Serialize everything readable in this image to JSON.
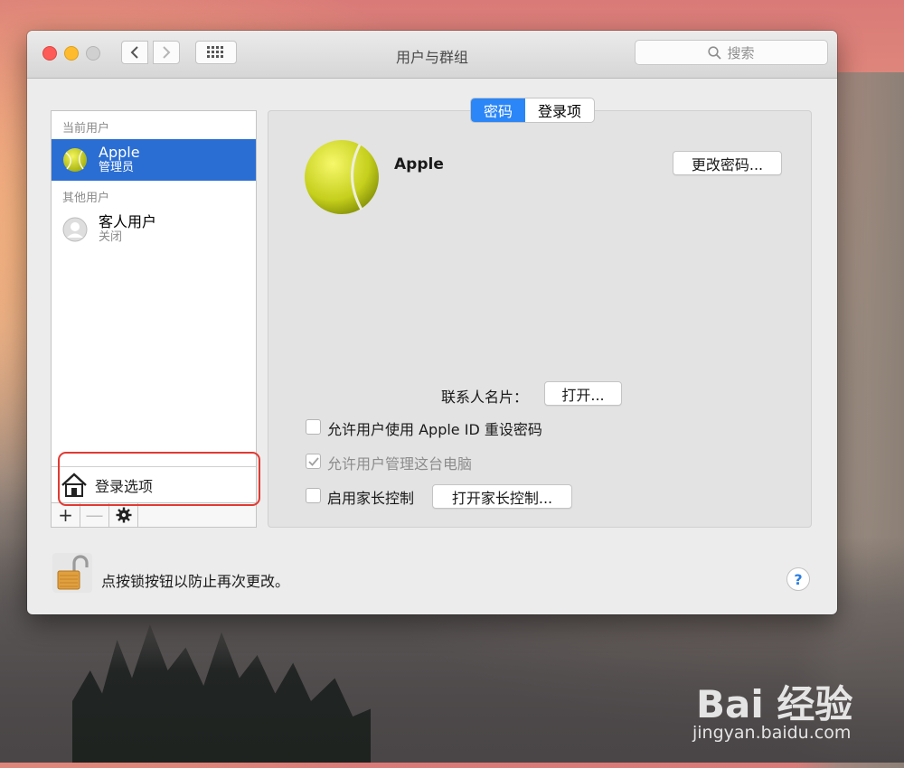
{
  "window": {
    "title": "用户与群组",
    "search_placeholder": "搜索"
  },
  "sidebar": {
    "current_header": "当前用户",
    "other_header": "其他用户",
    "users": [
      {
        "name": "Apple",
        "role": "管理员"
      },
      {
        "name": "客人用户",
        "role": "关闭"
      }
    ],
    "login_options_label": "登录选项",
    "add_label": "+",
    "remove_label": "—"
  },
  "tabs": [
    {
      "label": "密码"
    },
    {
      "label": "登录项"
    }
  ],
  "profile": {
    "name": "Apple",
    "change_password_button": "更改密码...",
    "contact_card_label": "联系人名片：",
    "contact_card_button": "打开...",
    "options": [
      {
        "label": "允许用户使用 Apple ID 重设密码",
        "checked": false
      },
      {
        "label": "允许用户管理这台电脑",
        "checked": true
      },
      {
        "label": "启用家长控制",
        "checked": false
      }
    ],
    "parental_controls_button": "打开家长控制..."
  },
  "footer": {
    "lock_text": "点按锁按钮以防止再次更改。",
    "help_label": "?"
  },
  "watermark": {
    "logo": "Bai 经验",
    "url": "jingyan.baidu.com"
  },
  "colors": {
    "selection": "#2b6ed3",
    "tab_active": "#2b86f7",
    "annotation": "#e13a33"
  }
}
